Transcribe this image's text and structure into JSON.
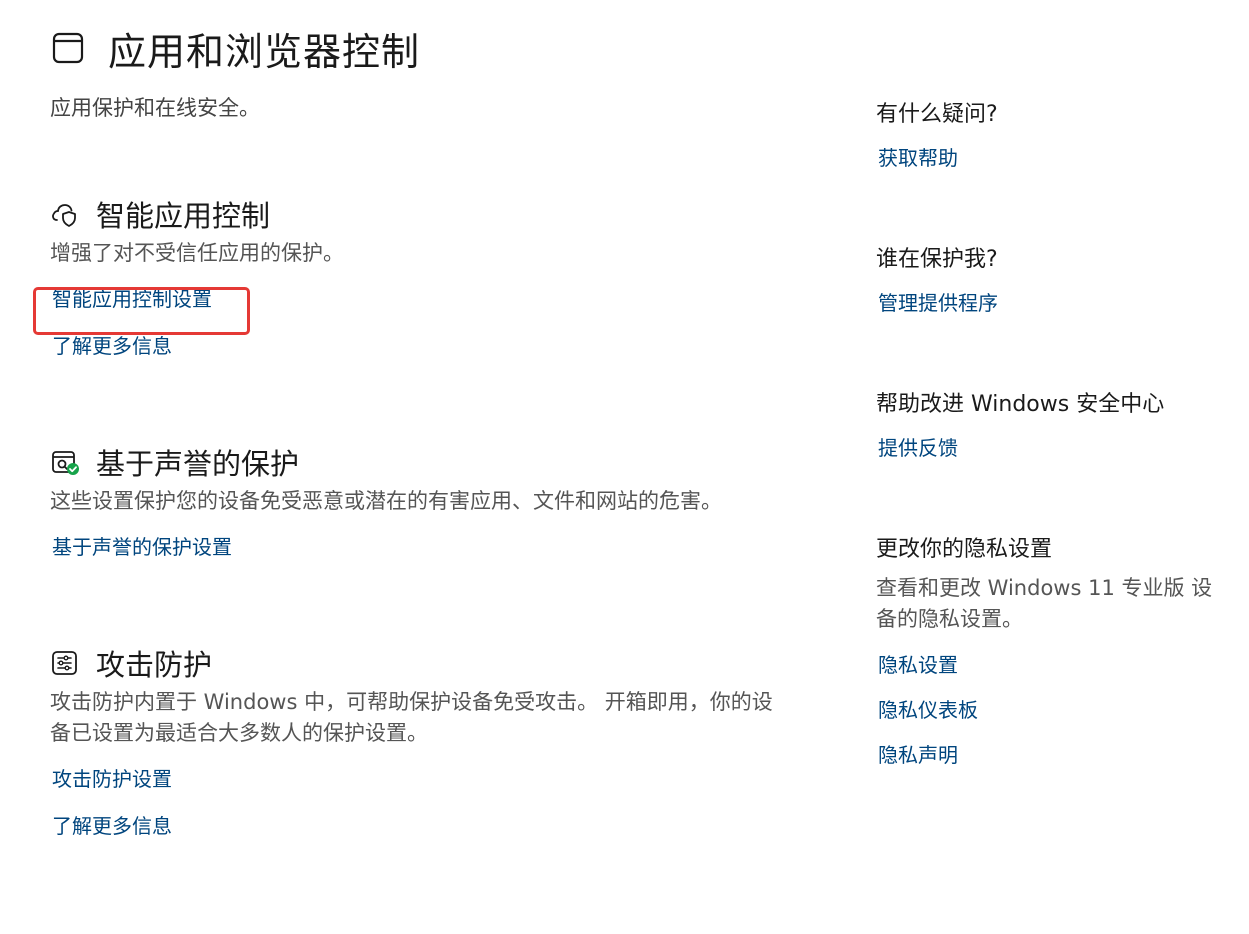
{
  "page": {
    "title": "应用和浏览器控制",
    "description": "应用保护和在线安全。",
    "icon": "app-window-icon"
  },
  "sections": [
    {
      "title": "智能应用控制",
      "icon": "cloud-shield-icon",
      "description": "增强了对不受信任应用的保护。",
      "links": [
        "智能应用控制设置",
        "了解更多信息"
      ]
    },
    {
      "title": "基于声誉的保护",
      "icon": "reputation-check-icon",
      "description": "这些设置保护您的设备免受恶意或潜在的有害应用、文件和网站的危害。",
      "links": [
        "基于声誉的保护设置"
      ]
    },
    {
      "title": "攻击防护",
      "icon": "exploit-sliders-icon",
      "description": "攻击防护内置于 Windows 中，可帮助保护设备免受攻击。 开箱即用，你的设备已设置为最适合大多数人的保护设置。",
      "links": [
        "攻击防护设置",
        "了解更多信息"
      ]
    }
  ],
  "sidebar": [
    {
      "title": "有什么疑问?",
      "links": [
        "获取帮助"
      ]
    },
    {
      "title": "谁在保护我?",
      "links": [
        "管理提供程序"
      ]
    },
    {
      "title": "帮助改进 Windows 安全中心",
      "links": [
        "提供反馈"
      ]
    },
    {
      "title": "更改你的隐私设置",
      "description": "查看和更改 Windows 11 专业版 设备的隐私设置。",
      "links": [
        "隐私设置",
        "隐私仪表板",
        "隐私声明"
      ]
    }
  ],
  "colors": {
    "link": "#00457e",
    "highlight": "#e53935",
    "check_badge": "#16a34a"
  }
}
